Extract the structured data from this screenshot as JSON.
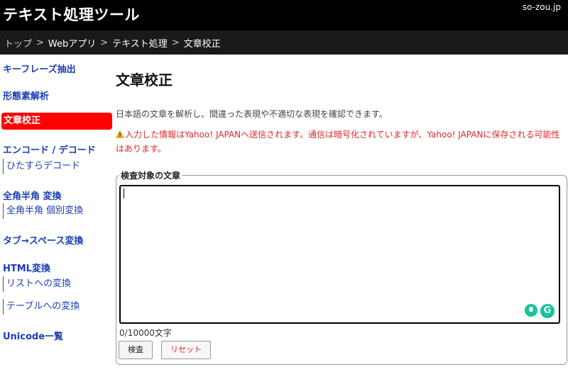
{
  "header": {
    "title": "テキスト処理ツール",
    "domain": "so-zou.jp"
  },
  "breadcrumb": {
    "items": [
      "トップ",
      "Webアプリ",
      "テキスト処理",
      "文章校正"
    ],
    "separator": ">"
  },
  "sidebar": {
    "keyphrase": "キーフレーズ抽出",
    "morph": "形態素解析",
    "proofread": "文章校正",
    "encode": "エンコード / デコード",
    "encode_sub": "ひたすらデコード",
    "zenhan": "全角半角 変換",
    "zenhan_sub": "全角半角 個別変換",
    "tab_space": "タブ→スペース変換",
    "html": "HTML変換",
    "html_sub1": "リストへの変換",
    "html_sub2": "テーブルへの変換",
    "unicode": "Unicode一覧"
  },
  "main": {
    "title": "文章校正",
    "description": "日本語の文章を解析し、間違った表現や不適切な表現を確認できます。",
    "warning": "入力した情報はYahoo! JAPANへ送信されます。通信は暗号化されていますが、Yahoo! JAPANに保存される可能性はあります。",
    "fieldset_legend": "検査対象の文章",
    "textarea_value": "",
    "counter": "0/10000文字",
    "check_button": "検査",
    "reset_button": "リセット"
  },
  "icons": {
    "warning": "warning-triangle-icon",
    "assist_bulb": "lightbulb-icon",
    "grammar": "grammarly-icon"
  },
  "colors": {
    "accent": "#ff0000",
    "link": "#1a3db4",
    "warning": "#e0272b",
    "header": "#000000"
  }
}
